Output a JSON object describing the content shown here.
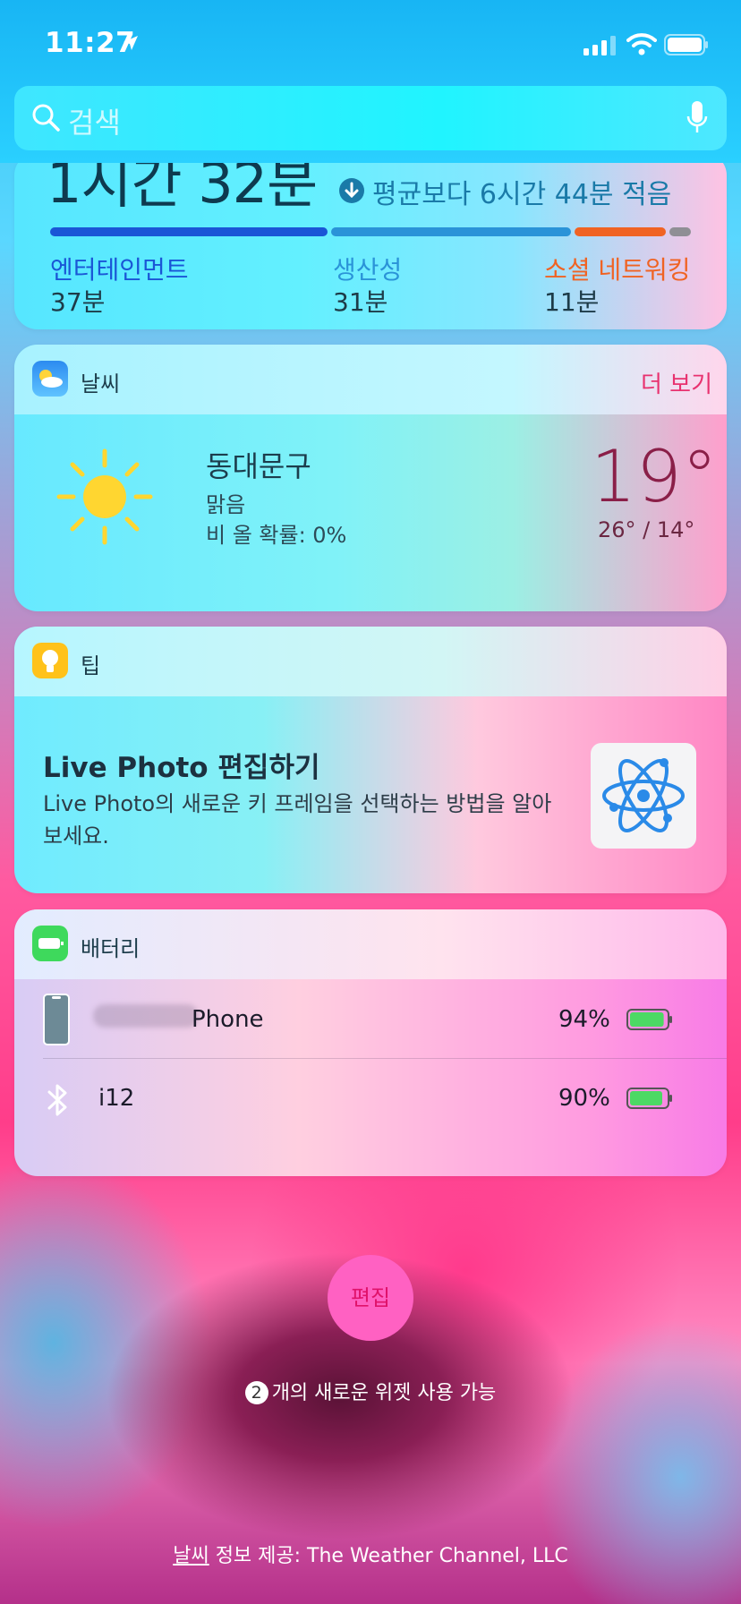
{
  "status": {
    "time": "11:27"
  },
  "search": {
    "placeholder": "검색"
  },
  "screen_time": {
    "total": "1시간 32분",
    "compare": "평균보다 6시간 44분 적음",
    "categories": [
      {
        "label": "엔터테인먼트",
        "value": "37분",
        "color": "#1a56d6"
      },
      {
        "label": "생산성",
        "value": "31분",
        "color": "#2a93d8"
      },
      {
        "label": "소셜 네트워킹",
        "value": "11분",
        "color": "#f06323"
      }
    ]
  },
  "weather": {
    "title": "날씨",
    "more": "더 보기",
    "city": "동대문구",
    "condition": "맑음",
    "rain": "비 올 확률: 0%",
    "temp": "19°",
    "hilo": "26° / 14°"
  },
  "tips": {
    "title": "팁",
    "headline": "Live Photo 편집하기",
    "body": "Live Photo의 새로운 키 프레임을 선택하는 방법을 알아보세요."
  },
  "battery": {
    "title": "배터리",
    "devices": [
      {
        "name": "Phone",
        "percent": "94%",
        "level": 0.94
      },
      {
        "name": "i12",
        "percent": "90%",
        "level": 0.9
      }
    ]
  },
  "footer": {
    "edit": "편집",
    "new_count": "2",
    "new_widgets": "개의 새로운 위젯 사용 가능",
    "credit_link": "날씨",
    "credit_text": " 정보 제공: The Weather Channel, LLC"
  }
}
